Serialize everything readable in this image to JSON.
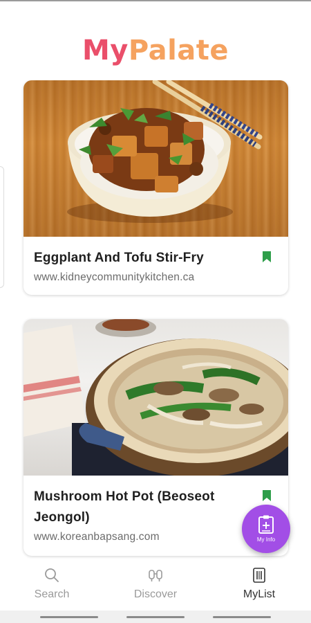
{
  "app": {
    "logo_part1": "My",
    "logo_part2": "Palate"
  },
  "recipes": [
    {
      "title": "Eggplant And Tofu Stir-Fry",
      "source": "www.kidneycommunitykitchen.ca",
      "image_icon": "eggplant-tofu-bowl-photo",
      "bookmarked": true
    },
    {
      "title": "Mushroom Hot Pot (Beoseot Jeongol)",
      "source": "www.koreanbapsang.com",
      "image_icon": "mushroom-hot-pot-photo",
      "bookmarked": true
    }
  ],
  "fab": {
    "label": "My Info",
    "icon": "clipboard-plus-icon"
  },
  "tabs": [
    {
      "label": "Search",
      "icon": "search-icon",
      "active": false
    },
    {
      "label": "Discover",
      "icon": "discover-icon",
      "active": false
    },
    {
      "label": "MyList",
      "icon": "mylist-icon",
      "active": true
    }
  ],
  "colors": {
    "logo_my": "#ea4f6a",
    "logo_palate": "#f5a25f",
    "bookmark": "#2e9e4a",
    "fab": "#a24ee6",
    "tab_inactive": "#9a9a9a",
    "tab_active": "#333333"
  }
}
